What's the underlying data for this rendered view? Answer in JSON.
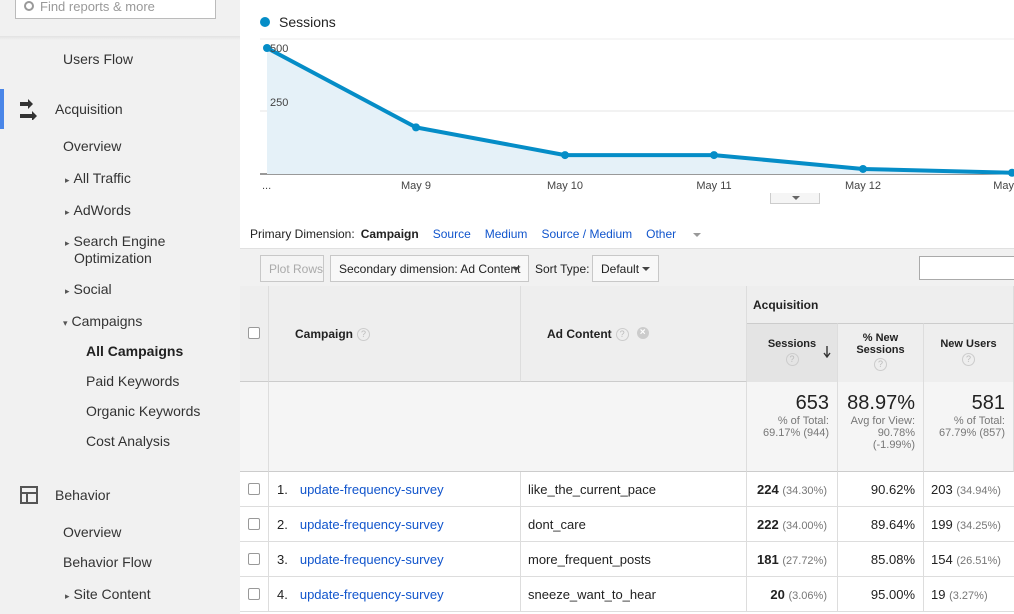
{
  "search": {
    "placeholder": "Find reports & more"
  },
  "sidebar": {
    "users_flow": "Users Flow",
    "acquisition": "Acquisition",
    "acq_items": {
      "overview": "Overview",
      "all_traffic": "All Traffic",
      "adwords": "AdWords",
      "seo_line1": "Search Engine",
      "seo_line2": "Optimization",
      "social": "Social",
      "campaigns": "Campaigns"
    },
    "campaign_items": {
      "all": "All Campaigns",
      "paid": "Paid Keywords",
      "organic": "Organic Keywords",
      "cost": "Cost Analysis"
    },
    "behavior": "Behavior",
    "beh_items": {
      "overview": "Overview",
      "flow": "Behavior Flow",
      "site_content": "Site Content"
    }
  },
  "chart_data": {
    "type": "area",
    "series": [
      {
        "name": "Sessions",
        "values": [
          500,
          185,
          75,
          75,
          20,
          5
        ],
        "color": "#058dc7"
      }
    ],
    "x": [
      "...",
      "May 9",
      "May 10",
      "May 11",
      "May 12",
      "May"
    ],
    "y_ticks": [
      "500",
      "250"
    ],
    "ylim": [
      0,
      500
    ],
    "grid": true
  },
  "dimensions": {
    "label": "Primary Dimension:",
    "selected": "Campaign",
    "options": [
      "Source",
      "Medium",
      "Source / Medium",
      "Other"
    ]
  },
  "toolbar": {
    "plot_rows": "Plot Rows",
    "secondary": "Secondary dimension: Ad Content",
    "sort_label": "Sort Type:",
    "sort_value": "Default"
  },
  "table": {
    "col_campaign": "Campaign",
    "col_ad_content": "Ad Content",
    "group_acquisition": "Acquisition",
    "col_sessions": "Sessions",
    "col_new_sessions": "% New Sessions",
    "col_new_users": "New Users",
    "totals": {
      "sessions": "653",
      "sessions_sub1": "% of Total:",
      "sessions_sub2": "69.17% (944)",
      "new_sessions": "88.97%",
      "new_sessions_sub1": "Avg for View:",
      "new_sessions_sub2": "90.78%",
      "new_sessions_sub3": "(-1.99%)",
      "new_users": "581",
      "new_users_sub1": "% of Total:",
      "new_users_sub2": "67.79% (857)"
    },
    "rows": [
      {
        "idx": "1.",
        "campaign": "update-frequency-survey",
        "ad": "like_the_current_pace",
        "sessions": "224",
        "sessions_pct": "(34.30%)",
        "new_sessions": "90.62%",
        "new_users": "203",
        "new_users_pct": "(34.94%)"
      },
      {
        "idx": "2.",
        "campaign": "update-frequency-survey",
        "ad": "dont_care",
        "sessions": "222",
        "sessions_pct": "(34.00%)",
        "new_sessions": "89.64%",
        "new_users": "199",
        "new_users_pct": "(34.25%)"
      },
      {
        "idx": "3.",
        "campaign": "update-frequency-survey",
        "ad": "more_frequent_posts",
        "sessions": "181",
        "sessions_pct": "(27.72%)",
        "new_sessions": "85.08%",
        "new_users": "154",
        "new_users_pct": "(26.51%)"
      },
      {
        "idx": "4.",
        "campaign": "update-frequency-survey",
        "ad": "sneeze_want_to_hear",
        "sessions": "20",
        "sessions_pct": "(3.06%)",
        "new_sessions": "95.00%",
        "new_users": "19",
        "new_users_pct": "(3.27%)"
      }
    ]
  }
}
